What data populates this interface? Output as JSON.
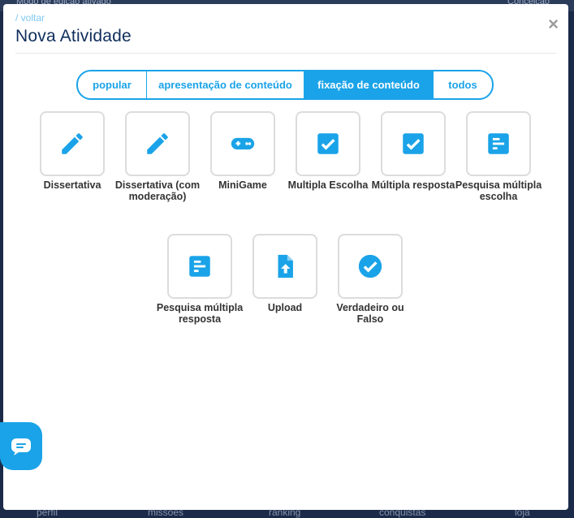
{
  "background": {
    "top_left_text": "Modo de edição ativado",
    "top_right_text": "Conceição",
    "bottom_nav": [
      "perfil",
      "missões",
      "ranking",
      "conquistas",
      "loja"
    ]
  },
  "modal": {
    "back_label": "/ voltar",
    "title": "Nova Atividade",
    "close_label": "×"
  },
  "tabs": [
    {
      "label": "popular",
      "active": false
    },
    {
      "label": "apresentação de conteúdo",
      "active": false
    },
    {
      "label": "fixação de conteúdo",
      "active": true
    },
    {
      "label": "todos",
      "active": false
    }
  ],
  "activities": [
    {
      "label": "Dissertativa",
      "icon": "pencil-icon"
    },
    {
      "label": "Dissertativa (com moderação)",
      "icon": "pencil-icon"
    },
    {
      "label": "MiniGame",
      "icon": "gamepad-icon"
    },
    {
      "label": "Multipla Escolha",
      "icon": "checkbox-icon"
    },
    {
      "label": "Múltipla resposta",
      "icon": "checkbox-icon"
    },
    {
      "label": "Pesquisa múltipla escolha",
      "icon": "poll-icon"
    },
    {
      "label": "Pesquisa múltipla resposta",
      "icon": "poll-icon"
    },
    {
      "label": "Upload",
      "icon": "upload-file-icon"
    },
    {
      "label": "Verdadeiro ou Falso",
      "icon": "check-circle-icon"
    }
  ],
  "colors": {
    "accent": "#1aa3e8",
    "title": "#0f2e5b",
    "tile_border": "#dcdcdc"
  }
}
